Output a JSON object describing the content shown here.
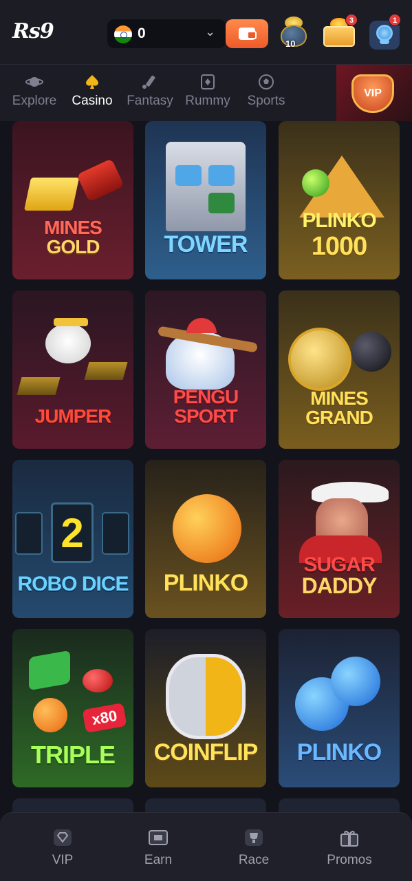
{
  "header": {
    "logo": "Rs9",
    "balance": "0",
    "pot_count": "10",
    "chest_badge": "3",
    "support_badge": "1"
  },
  "nav": {
    "items": [
      {
        "label": "Explore",
        "icon": "planet-icon"
      },
      {
        "label": "Casino",
        "icon": "spade-icon",
        "active": true
      },
      {
        "label": "Fantasy",
        "icon": "cricket-bat-icon"
      },
      {
        "label": "Rummy",
        "icon": "cards-icon"
      },
      {
        "label": "Sports",
        "icon": "football-icon"
      }
    ],
    "vip_label": "VIP"
  },
  "games": [
    {
      "title_line1": "MINES",
      "title_line2": "GOLD",
      "bg": "#5a1a26"
    },
    {
      "title_line1": "TOWER",
      "title_line2": "",
      "bg": "#24456b"
    },
    {
      "title_line1": "PLINKO",
      "title_line2": "1000",
      "bg": "#6a5420"
    },
    {
      "title_line1": "JUMPER",
      "title_line2": "",
      "bg": "#4a1624"
    },
    {
      "title_line1": "PENGU",
      "title_line2": "SPORT",
      "bg": "#4d1a2a"
    },
    {
      "title_line1": "MINES",
      "title_line2": "GRAND",
      "bg": "#6a5218"
    },
    {
      "title_line1": "ROBO DICE",
      "title_line2": "",
      "bg": "#1f3f62"
    },
    {
      "title_line1": "PLINKO",
      "title_line2": "",
      "bg": "#5e4a1a"
    },
    {
      "title_line1": "SUGAR",
      "title_line2": "DADDY",
      "bg": "#4d1820"
    },
    {
      "title_line1": "TRIPLE",
      "title_line2": "",
      "bg": "#2e5a22"
    },
    {
      "title_line1": "COINFLIP",
      "title_line2": "",
      "bg": "#5e4a16"
    },
    {
      "title_line1": "PLINKO",
      "title_line2": "",
      "bg": "#1e3d6a"
    }
  ],
  "tabbar": {
    "items": [
      {
        "label": "VIP",
        "icon": "diamond-icon"
      },
      {
        "label": "Earn",
        "icon": "ticket-icon"
      },
      {
        "label": "Race",
        "icon": "trophy-icon"
      },
      {
        "label": "Promos",
        "icon": "gift-icon"
      }
    ]
  }
}
